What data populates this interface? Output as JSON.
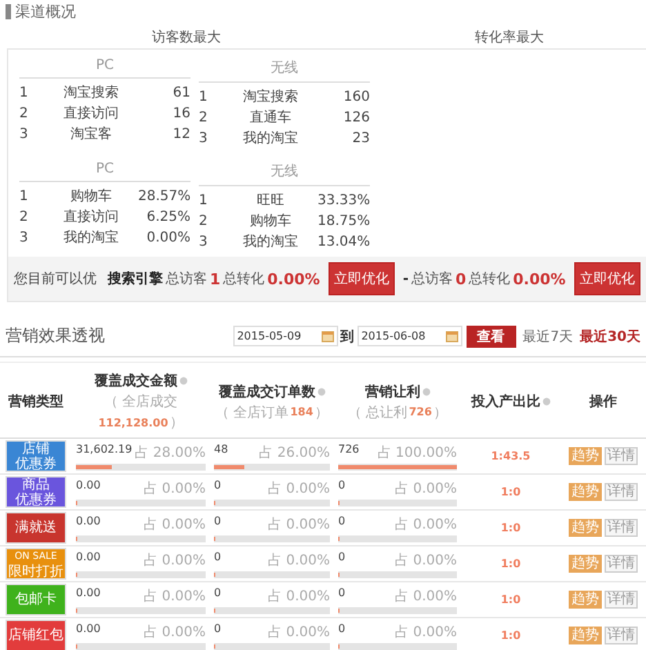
{
  "page_title": "渠道概况",
  "headings": [
    "访客数最大",
    "转化率最大"
  ],
  "table_groups": [
    {
      "tables": [
        {
          "title": "PC",
          "rows": [
            {
              "rank": "1",
              "channel": "淘宝搜索",
              "value": "61"
            },
            {
              "rank": "2",
              "channel": "直接访问",
              "value": "16"
            },
            {
              "rank": "3",
              "channel": "淘宝客",
              "value": "12"
            }
          ]
        },
        {
          "title": "无线",
          "rows": [
            {
              "rank": "1",
              "channel": "淘宝搜索",
              "value": "160"
            },
            {
              "rank": "2",
              "channel": "直通车",
              "value": "126"
            },
            {
              "rank": "3",
              "channel": "我的淘宝",
              "value": "23"
            }
          ]
        }
      ]
    },
    {
      "tables": [
        {
          "title": "PC",
          "rows": [
            {
              "rank": "1",
              "channel": "购物车",
              "value": "28.57%"
            },
            {
              "rank": "2",
              "channel": "直接访问",
              "value": "6.25%"
            },
            {
              "rank": "3",
              "channel": "我的淘宝",
              "value": "0.00%"
            }
          ]
        },
        {
          "title": "无线",
          "rows": [
            {
              "rank": "1",
              "channel": "旺旺",
              "value": "33.33%"
            },
            {
              "rank": "2",
              "channel": "购物车",
              "value": "18.75%"
            },
            {
              "rank": "3",
              "channel": "我的淘宝",
              "value": "13.04%"
            }
          ]
        }
      ]
    }
  ],
  "footer": {
    "label": "您目前可以优",
    "items": [
      {
        "channel": "搜索引擎",
        "visitors_label": "总访客",
        "visitors": "1",
        "conversion_label": "总转化",
        "conversion": "0.00%",
        "button": "立即优化"
      },
      {
        "channel": "-",
        "visitors_label": "总访客",
        "visitors": "0",
        "conversion_label": "总转化",
        "conversion": "0.00%",
        "button": "立即优化"
      }
    ]
  },
  "marketing": {
    "title": "营销效果透视",
    "date_from": "2015-05-09",
    "separator": "到",
    "date_to": "2015-06-08",
    "query_button": "查看",
    "ranges": [
      {
        "label": "最近7天",
        "selected": false
      },
      {
        "label": "最近30天",
        "selected": true
      }
    ],
    "columns": [
      {
        "label": "营销类型"
      },
      {
        "label": "覆盖成交金额",
        "help": true,
        "note_label": "（ 全店成交",
        "note_value": "112,128.00",
        "note_close": "）"
      },
      {
        "label": "覆盖成交订单数",
        "help": true,
        "note_label": "（ 全店订单",
        "note_value": "184",
        "note_close": "）"
      },
      {
        "label": "营销让利",
        "help": true,
        "note_label": "（ 总让利",
        "note_value": "726",
        "note_close": "）"
      },
      {
        "label": "投入产出比",
        "help": true
      },
      {
        "label": "操作"
      }
    ],
    "rows": [
      {
        "badge": [
          "店铺",
          "优惠券"
        ],
        "color": "#3a86d4",
        "metrics": [
          {
            "value": "31,602.19",
            "share": "占 28.00%",
            "level": 0.28
          },
          {
            "value": "48",
            "share": "占 26.00%",
            "level": 0.26
          },
          {
            "value": "726",
            "share": "占 100.00%",
            "level": 1
          }
        ],
        "roi": "1:43.5",
        "actions": [
          "趋势",
          "详情"
        ]
      },
      {
        "badge": [
          "商品",
          "优惠券"
        ],
        "color": "#6a55dd",
        "metrics": [
          {
            "value": "0.00",
            "share": "占 0.00%",
            "level": 0
          },
          {
            "value": "0",
            "share": "占 0.00%",
            "level": 0
          },
          {
            "value": "0",
            "share": "占 0.00%",
            "level": 0
          }
        ],
        "roi": "1:0",
        "actions": [
          "趋势",
          "详情"
        ]
      },
      {
        "badge": [
          "满就送"
        ],
        "color": "#c8352e",
        "metrics": [
          {
            "value": "0.00",
            "share": "占 0.00%",
            "level": 0
          },
          {
            "value": "0",
            "share": "占 0.00%",
            "level": 0
          },
          {
            "value": "0",
            "share": "占 0.00%",
            "level": 0
          }
        ],
        "roi": "1:0",
        "actions": [
          "趋势",
          "详情"
        ]
      },
      {
        "badge": [
          "ON SALE",
          "限时打折"
        ],
        "color": "#e8900e",
        "metrics": [
          {
            "value": "0.00",
            "share": "占 0.00%",
            "level": 0
          },
          {
            "value": "0",
            "share": "占 0.00%",
            "level": 0
          },
          {
            "value": "0",
            "share": "占 0.00%",
            "level": 0
          }
        ],
        "roi": "1:0",
        "actions": [
          "趋势",
          "详情"
        ]
      },
      {
        "badge": [
          "包邮卡"
        ],
        "color": "#3fb21c",
        "metrics": [
          {
            "value": "0.00",
            "share": "占 0.00%",
            "level": 0
          },
          {
            "value": "0",
            "share": "占 0.00%",
            "level": 0
          },
          {
            "value": "0",
            "share": "占 0.00%",
            "level": 0
          }
        ],
        "roi": "1:0",
        "actions": [
          "趋势",
          "详情"
        ]
      },
      {
        "badge": [
          "店铺红包"
        ],
        "color": "#e23c3c",
        "metrics": [
          {
            "value": "0.00",
            "share": "占 0.00%",
            "level": 0
          },
          {
            "value": "0",
            "share": "占 0.00%",
            "level": 0
          },
          {
            "value": "0",
            "share": "占 0.00%",
            "level": 0
          }
        ],
        "roi": "1:0",
        "actions": [
          "趋势",
          "详情"
        ]
      }
    ]
  }
}
